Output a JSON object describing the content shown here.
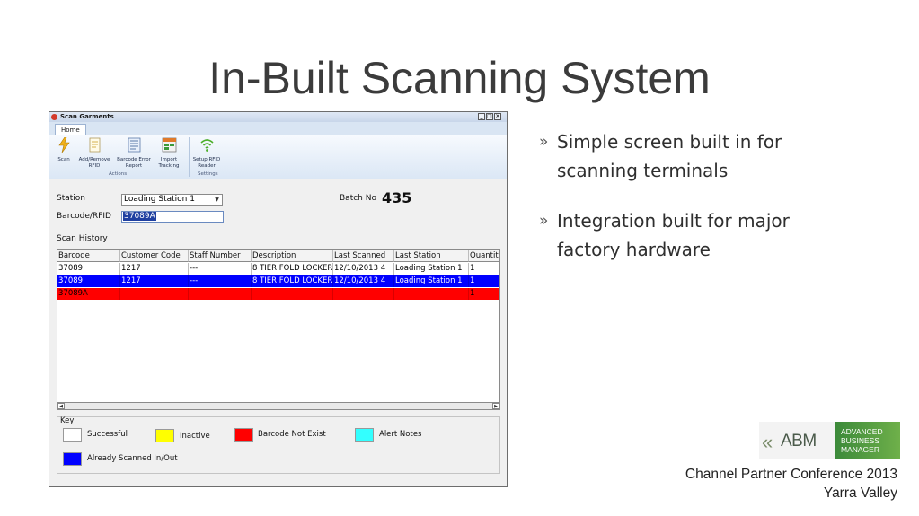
{
  "slide": {
    "title": "In-Built Scanning System",
    "bullets": [
      "Simple screen built in for scanning terminals",
      "Integration built for major factory hardware"
    ],
    "footer": [
      "Channel Partner Conference 2013",
      "Yarra Valley"
    ],
    "logo": {
      "abm": "ABM",
      "line1": "ADVANCED",
      "line2": "BUSINESS",
      "line3": "MANAGER"
    }
  },
  "window": {
    "title": "Scan Garments",
    "controls": {
      "minimize": "_",
      "maximize": "□",
      "close": "×"
    },
    "tab": "Home",
    "ribbon": {
      "buttons": [
        {
          "label": "Scan",
          "icon": "lightning-icon"
        },
        {
          "label": "Add/Remove RFID",
          "icon": "document-icon"
        },
        {
          "label": "Barcode Error Report",
          "icon": "report-icon"
        },
        {
          "label": "Import Tracking",
          "icon": "import-icon"
        },
        {
          "label": "Setup RFID Reader",
          "icon": "wireless-icon"
        }
      ],
      "groups": [
        "Actions",
        "Settings"
      ]
    },
    "form": {
      "station_label": "Station",
      "station_value": "Loading Station 1",
      "barcode_label": "Barcode/RFID",
      "barcode_value": "37089A",
      "batch_label": "Batch No",
      "batch_value": "435",
      "history_label": "Scan History"
    },
    "table": {
      "columns": [
        "Barcode",
        "Customer Code",
        "Staff Number",
        "Description",
        "Last Scanned",
        "Last Station",
        "Quantity"
      ],
      "rows": [
        {
          "cells": [
            "37089",
            "1217",
            "---",
            "8 TIER FOLD LOCKER",
            "12/10/2013 4",
            "Loading Station 1",
            "1"
          ],
          "status": "successful"
        },
        {
          "cells": [
            "37089",
            "1217",
            "---",
            "8 TIER FOLD LOCKER",
            "12/10/2013 4",
            "Loading Station 1",
            "1"
          ],
          "status": "already-scanned"
        },
        {
          "cells": [
            "37089A",
            "",
            "",
            "",
            "",
            "",
            "1"
          ],
          "status": "not-exist"
        }
      ]
    },
    "key": {
      "title": "Key",
      "items": [
        {
          "label": "Successful",
          "color": "#ffffff"
        },
        {
          "label": "Inactive",
          "color": "#ffff00"
        },
        {
          "label": "Barcode Not Exist",
          "color": "#ff0000"
        },
        {
          "label": "Alert Notes",
          "color": "#33ffff"
        },
        {
          "label": "Already Scanned In/Out",
          "color": "#0000ff"
        }
      ]
    },
    "status_colors": {
      "successful": "#ffffff",
      "already-scanned": "#0000ff",
      "not-exist": "#ff0000"
    }
  }
}
